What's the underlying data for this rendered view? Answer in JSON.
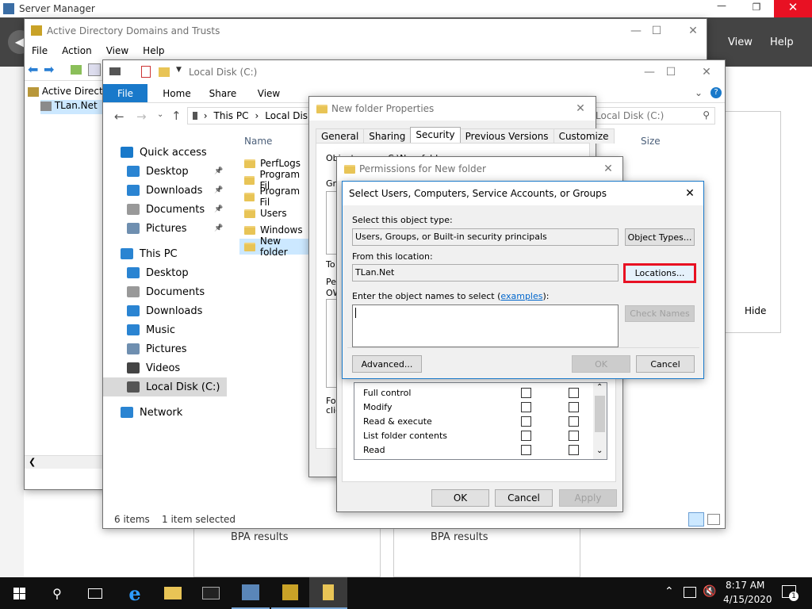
{
  "server_manager": {
    "title": "Server Manager",
    "menu": [
      "View",
      "Help"
    ],
    "hide_label": "Hide",
    "bpa": [
      "BPA results",
      "BPA results"
    ]
  },
  "addt": {
    "title": "Active Directory Domains and Trusts",
    "menu": [
      "File",
      "Action",
      "View",
      "Help"
    ],
    "tree": [
      "Active Directo",
      "TLan.Net"
    ]
  },
  "explorer": {
    "title": "Local Disk (C:)",
    "ribbon_tabs": [
      "File",
      "Home",
      "Share",
      "View"
    ],
    "breadcrumb": [
      "This PC",
      "Local Disk"
    ],
    "search_placeholder": "Local Disk (C:)",
    "columns": {
      "name": "Name",
      "size": "Size"
    },
    "nav": [
      {
        "label": "Quick access",
        "icon": "star-icon",
        "pin": false
      },
      {
        "label": "Desktop",
        "icon": "desktop-icon",
        "pin": true
      },
      {
        "label": "Downloads",
        "icon": "download-icon",
        "pin": true
      },
      {
        "label": "Documents",
        "icon": "documents-icon",
        "pin": true
      },
      {
        "label": "Pictures",
        "icon": "pictures-icon",
        "pin": true
      },
      {
        "label": "This PC",
        "icon": "computer-icon",
        "pin": false
      },
      {
        "label": "Desktop",
        "icon": "desktop-icon",
        "pin": false
      },
      {
        "label": "Documents",
        "icon": "documents-icon",
        "pin": false
      },
      {
        "label": "Downloads",
        "icon": "download-icon",
        "pin": false
      },
      {
        "label": "Music",
        "icon": "music-icon",
        "pin": false
      },
      {
        "label": "Pictures",
        "icon": "pictures-icon",
        "pin": false
      },
      {
        "label": "Videos",
        "icon": "videos-icon",
        "pin": false
      },
      {
        "label": "Local Disk (C:)",
        "icon": "drive-icon",
        "pin": false
      },
      {
        "label": "Network",
        "icon": "network-icon",
        "pin": false
      }
    ],
    "files": [
      "PerfLogs",
      "Program Fil",
      "Program Fil",
      "Users",
      "Windows",
      "New folder"
    ],
    "status": {
      "items": "6 items",
      "selected": "1 item selected"
    }
  },
  "props": {
    "title": "New folder Properties",
    "tabs": [
      "General",
      "Sharing",
      "Security",
      "Previous Versions",
      "Customize"
    ],
    "obj_name": "Object name:",
    "obj_value": "C:\\New folder",
    "frag": [
      "Gro",
      "To",
      "Pe",
      "OW",
      "For",
      "clic"
    ]
  },
  "perms": {
    "title": "Permissions for New folder",
    "rows": [
      "Full control",
      "Modify",
      "Read & execute",
      "List folder contents",
      "Read"
    ],
    "ok": "OK",
    "cancel": "Cancel",
    "apply": "Apply"
  },
  "select": {
    "title": "Select Users, Computers, Service Accounts, or Groups",
    "type_label": "Select this object type:",
    "type_value": "Users, Groups, or Built-in security principals",
    "object_types_btn": "Object Types...",
    "location_label": "From this location:",
    "location_value": "TLan.Net",
    "locations_btn": "Locations...",
    "names_label_pre": "Enter the object names to select (",
    "names_link": "examples",
    "names_label_post": "):",
    "check_names_btn": "Check Names",
    "advanced_btn": "Advanced...",
    "ok_btn": "OK",
    "cancel_btn": "Cancel"
  },
  "taskbar": {
    "time": "8:17 AM",
    "date": "4/15/2020",
    "notif_count": "1"
  },
  "colors": {
    "accent": "#0078d7",
    "highlight": "#e81123",
    "link": "#0066cc"
  }
}
